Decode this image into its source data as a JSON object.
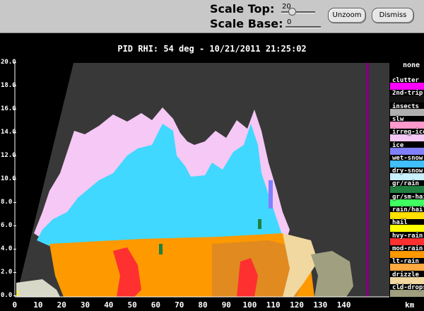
{
  "toolbar": {
    "scale_top_label": "Scale Top:",
    "scale_top_value": "20",
    "scale_base_label": "Scale Base:",
    "scale_base_value": "0",
    "unzoom_label": "Unzoom",
    "dismiss_label": "Dismiss"
  },
  "plot": {
    "title": "PID  RHI: 54 deg  -  10/21/2011 21:25:02",
    "y_ticks": [
      "20.0",
      "18.0",
      "16.0",
      "14.0",
      "12.0",
      "10.0",
      "8.0",
      "6.0",
      "4.0",
      "2.0",
      "0.0"
    ],
    "x_ticks": [
      "0",
      "10",
      "20",
      "30",
      "40",
      "50",
      "60",
      "70",
      "80",
      "90",
      "100",
      "110",
      "120",
      "130",
      "140"
    ],
    "x_unit": "km",
    "corner_left": "1",
    "corner_right": "2"
  },
  "legend": {
    "header": "none",
    "items": [
      {
        "label": "clutter",
        "color": "#ff00ff"
      },
      {
        "label": "2nd-trip",
        "color": "#111111"
      },
      {
        "label": "insects",
        "color": "#b0b0b0"
      },
      {
        "label": "slw",
        "color": "#ff99cc"
      },
      {
        "label": "irreg-ice",
        "color": "#f5c8f5"
      },
      {
        "label": "ice",
        "color": "#8080ff"
      },
      {
        "label": "wet-snow",
        "color": "#40c0ff"
      },
      {
        "label": "dry-snow",
        "color": "#c8f0ff"
      },
      {
        "label": "gr/rain",
        "color": "#208040"
      },
      {
        "label": "gr/sm-hail",
        "color": "#40ff60"
      },
      {
        "label": "rain/hail",
        "color": "#ffe000"
      },
      {
        "label": "hail",
        "color": "#ffff00"
      },
      {
        "label": "hvy-rain",
        "color": "#ff3030"
      },
      {
        "label": "mod-rain",
        "color": "#ff9900"
      },
      {
        "label": "lt-rain",
        "color": "#ffaa40"
      },
      {
        "label": "drizzle",
        "color": "#f0d8a0"
      },
      {
        "label": "cld-drops",
        "color": "#a0a080"
      }
    ]
  },
  "colors": {
    "background": "#383838",
    "stripe": "#800080"
  }
}
